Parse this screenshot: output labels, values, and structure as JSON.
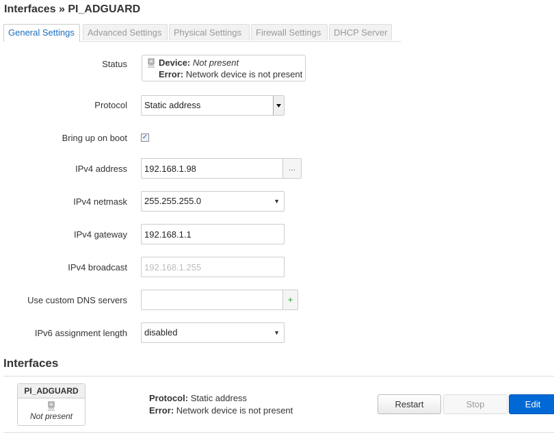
{
  "page": {
    "title": "Interfaces » PI_ADGUARD"
  },
  "tabs": [
    {
      "label": "General Settings"
    },
    {
      "label": "Advanced Settings"
    },
    {
      "label": "Physical Settings"
    },
    {
      "label": "Firewall Settings"
    },
    {
      "label": "DHCP Server"
    }
  ],
  "form": {
    "status": {
      "label": "Status",
      "device_key": "Device:",
      "device_value": "Not present",
      "error_key": "Error:",
      "error_value": "Network device is not present"
    },
    "protocol": {
      "label": "Protocol",
      "value": "Static address"
    },
    "boot": {
      "label": "Bring up on boot",
      "checked": true,
      "check_glyph": "✓"
    },
    "ipv4_address": {
      "label": "IPv4 address",
      "value": "192.168.1.98",
      "button": "..."
    },
    "ipv4_netmask": {
      "label": "IPv4 netmask",
      "value": "255.255.255.0"
    },
    "ipv4_gateway": {
      "label": "IPv4 gateway",
      "value": "192.168.1.1"
    },
    "ipv4_broadcast": {
      "label": "IPv4 broadcast",
      "placeholder": "192.168.1.255"
    },
    "dns": {
      "label": "Use custom DNS servers",
      "value": "",
      "button": "+"
    },
    "ipv6_length": {
      "label": "IPv6 assignment length",
      "value": "disabled"
    }
  },
  "interfaces_section": {
    "title": "Interfaces",
    "badge": {
      "name": "PI_ADGUARD",
      "status": "Not present"
    },
    "protocol_key": "Protocol:",
    "protocol_value": "Static address",
    "error_key": "Error:",
    "error_value": "Network device is not present",
    "buttons": {
      "restart": "Restart",
      "stop": "Stop",
      "edit": "Edit"
    }
  },
  "colors": {
    "accent": "#0069d6",
    "tab_active_text": "#1a6ebf"
  },
  "icons": {
    "device": "ethernet-port-icon",
    "select": "dropdown-arrow-icon"
  }
}
